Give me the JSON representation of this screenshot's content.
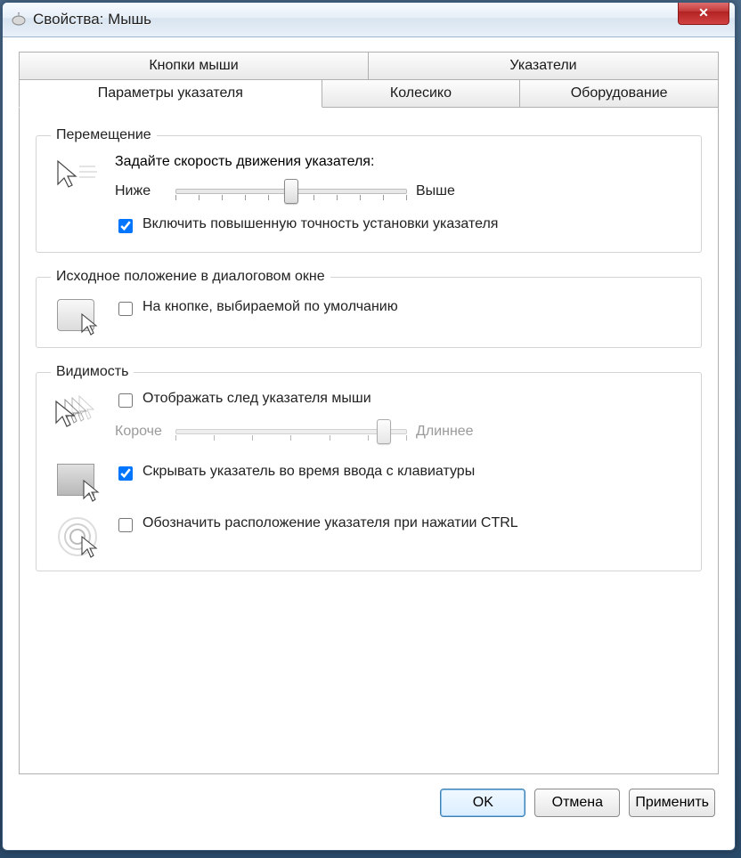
{
  "title": "Свойства: Мышь",
  "tabs_row1": [
    "Кнопки мыши",
    "Указатели"
  ],
  "tabs_row2": [
    "Параметры указателя",
    "Колесико",
    "Оборудование"
  ],
  "active_tab": "Параметры указателя",
  "groups": {
    "motion": {
      "legend": "Перемещение",
      "label": "Задайте скорость движения указателя:",
      "low": "Ниже",
      "high": "Выше",
      "slider_pos_percent": 50,
      "enhance": {
        "checked": true,
        "label": "Включить повышенную точность установки указателя"
      }
    },
    "snap": {
      "legend": "Исходное положение в диалоговом окне",
      "snap_to": {
        "checked": false,
        "label": "На кнопке, выбираемой по умолчанию"
      }
    },
    "visibility": {
      "legend": "Видимость",
      "trails": {
        "checked": false,
        "label": "Отображать след указателя мыши"
      },
      "trails_short": "Короче",
      "trails_long": "Длиннее",
      "trails_pos_percent": 90,
      "hide_typing": {
        "checked": true,
        "label": "Скрывать указатель во время ввода с клавиатуры"
      },
      "ctrl_locate": {
        "checked": false,
        "label": "Обозначить расположение указателя при нажатии CTRL"
      }
    }
  },
  "buttons": {
    "ok": "OK",
    "cancel": "Отмена",
    "apply": "Применить"
  }
}
